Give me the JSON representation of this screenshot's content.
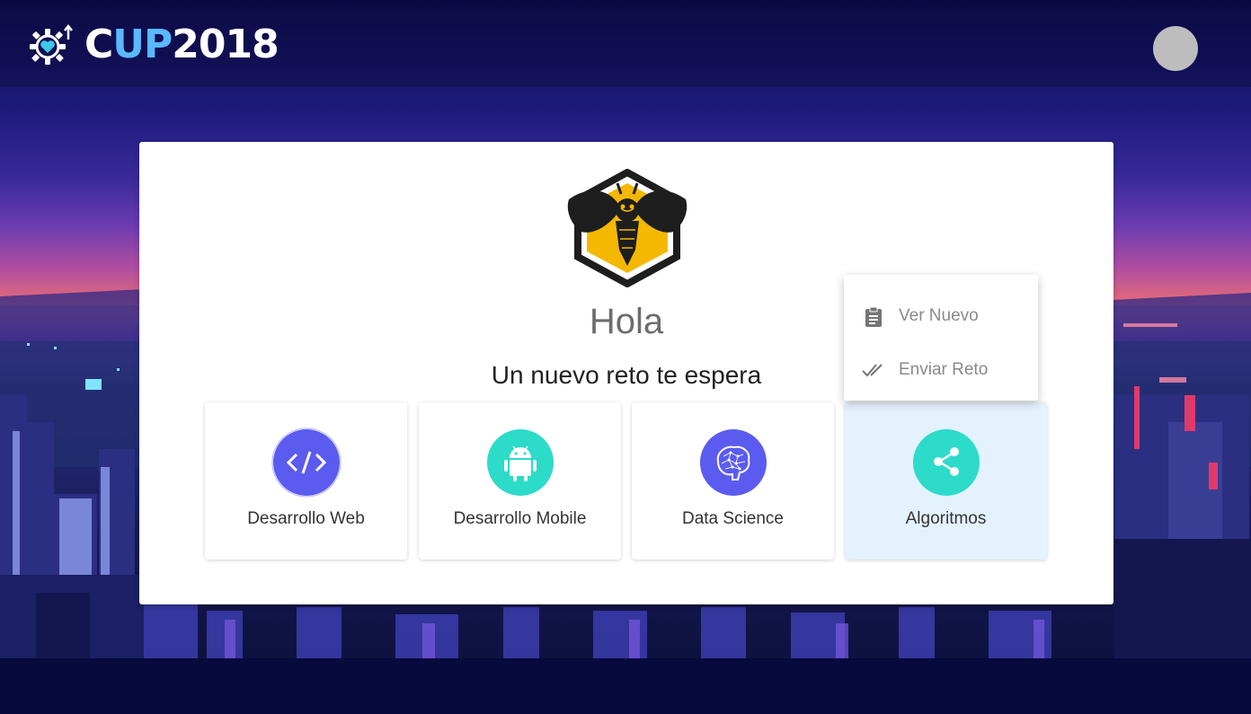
{
  "header": {
    "logo": {
      "prefix": "C",
      "highlight": "UP",
      "suffix": "2018"
    },
    "avatar_color": "#bdbdbd"
  },
  "card": {
    "greeting": "Hola",
    "subtitle": "Un nuevo reto te espera"
  },
  "tiles": [
    {
      "label": "Desarrollo Web",
      "icon": "code-icon",
      "color": "#5b5bf0",
      "active": false
    },
    {
      "label": "Desarrollo Mobile",
      "icon": "android-icon",
      "color": "#2ddbc9",
      "active": false
    },
    {
      "label": "Data Science",
      "icon": "brain-icon",
      "color": "#5b5bf0",
      "active": false
    },
    {
      "label": "Algoritmos",
      "icon": "share-icon",
      "color": "#2ddbc9",
      "active": true
    }
  ],
  "menu": {
    "items": [
      {
        "label": "Ver Nuevo",
        "icon": "clipboard-icon"
      },
      {
        "label": "Enviar Reto",
        "icon": "double-check-icon"
      }
    ]
  },
  "colors": {
    "accent_purple": "#5b5bf0",
    "accent_teal": "#2ddbc9",
    "emblem_yellow": "#f5b800",
    "active_tile": "#e4f2fd"
  }
}
